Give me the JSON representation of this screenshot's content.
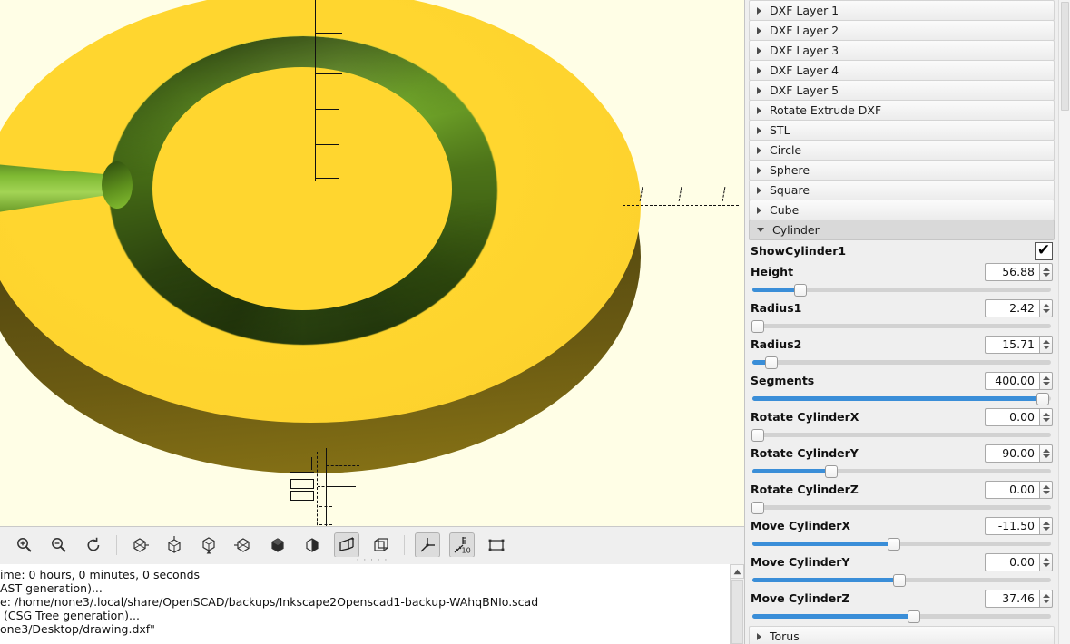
{
  "viewport": {
    "name": "3d-preview",
    "background_color": "#FFFEE6",
    "model_yellow": "#FFD62F",
    "model_green": "#8CC63F",
    "model_dark": "#4E4410"
  },
  "toolbar": {
    "buttons": [
      {
        "name": "zoom-in-icon",
        "label": "Zoom In",
        "pressed": false
      },
      {
        "name": "zoom-out-icon",
        "label": "Zoom Out",
        "pressed": false
      },
      {
        "name": "reset-view-icon",
        "label": "Reset View",
        "pressed": false
      },
      {
        "name": "view-right-icon",
        "label": "Right View",
        "pressed": false
      },
      {
        "name": "view-top-icon",
        "label": "Top View",
        "pressed": false
      },
      {
        "name": "view-bottom-icon",
        "label": "Bottom View",
        "pressed": false
      },
      {
        "name": "view-left-icon",
        "label": "Left View",
        "pressed": false
      },
      {
        "name": "view-front-icon",
        "label": "Front View",
        "pressed": false
      },
      {
        "name": "view-back-icon",
        "label": "Back View",
        "pressed": false
      },
      {
        "name": "perspective-icon",
        "label": "Perspective",
        "pressed": true
      },
      {
        "name": "orthogonal-icon",
        "label": "Orthogonal",
        "pressed": false
      },
      {
        "name": "show-axes-icon",
        "label": "Show Axes",
        "pressed": true
      },
      {
        "name": "show-scale-markers-icon",
        "label": "Show Scale Markers",
        "pressed": true
      },
      {
        "name": "show-edges-icon",
        "label": "Show Edges",
        "pressed": false
      }
    ]
  },
  "console": {
    "lines": [
      "ime: 0 hours, 0 minutes, 0 seconds",
      "",
      "AST generation)...",
      "e: /home/none3/.local/share/OpenSCAD/backups/Inkscape2Openscad1-backup-WAhqBNIo.scad",
      " (CSG Tree generation)...",
      "one3/Desktop/drawing.dxf\""
    ]
  },
  "panel": {
    "collapsed_groups_top": [
      {
        "label": "DXF Layer 1"
      },
      {
        "label": "DXF Layer 2"
      },
      {
        "label": "DXF Layer 3"
      },
      {
        "label": "DXF Layer 4"
      },
      {
        "label": "DXF Layer 5"
      },
      {
        "label": "Rotate Extrude DXF"
      },
      {
        "label": "STL"
      },
      {
        "label": "Circle"
      },
      {
        "label": "Sphere"
      },
      {
        "label": "Square"
      },
      {
        "label": "Cube"
      }
    ],
    "open_group": {
      "label": "Cylinder"
    },
    "collapsed_groups_bottom": [
      {
        "label": "Torus"
      }
    ],
    "checkbox_param": {
      "label": "ShowCylinder1",
      "checked": true,
      "glyph": "✔"
    },
    "slider_params": [
      {
        "label": "Height",
        "value": "56.88",
        "fill_pct": 15
      },
      {
        "label": "Radius1",
        "value": "2.42",
        "fill_pct": 1
      },
      {
        "label": "Radius2",
        "value": "15.71",
        "fill_pct": 6
      },
      {
        "label": "Segments",
        "value": "400.00",
        "fill_pct": 98
      },
      {
        "label": "Rotate CylinderX",
        "value": "0.00",
        "fill_pct": 0
      },
      {
        "label": "Rotate CylinderY",
        "value": "90.00",
        "fill_pct": 26
      },
      {
        "label": "Rotate CylinderZ",
        "value": "0.00",
        "fill_pct": 0
      },
      {
        "label": "Move CylinderX",
        "value": "-11.50",
        "fill_pct": 47
      },
      {
        "label": "Move CylinderY",
        "value": "0.00",
        "fill_pct": 49
      },
      {
        "label": "Move CylinderZ",
        "value": "37.46",
        "fill_pct": 54
      }
    ],
    "slider_fill_color": "#3A8ED8"
  }
}
